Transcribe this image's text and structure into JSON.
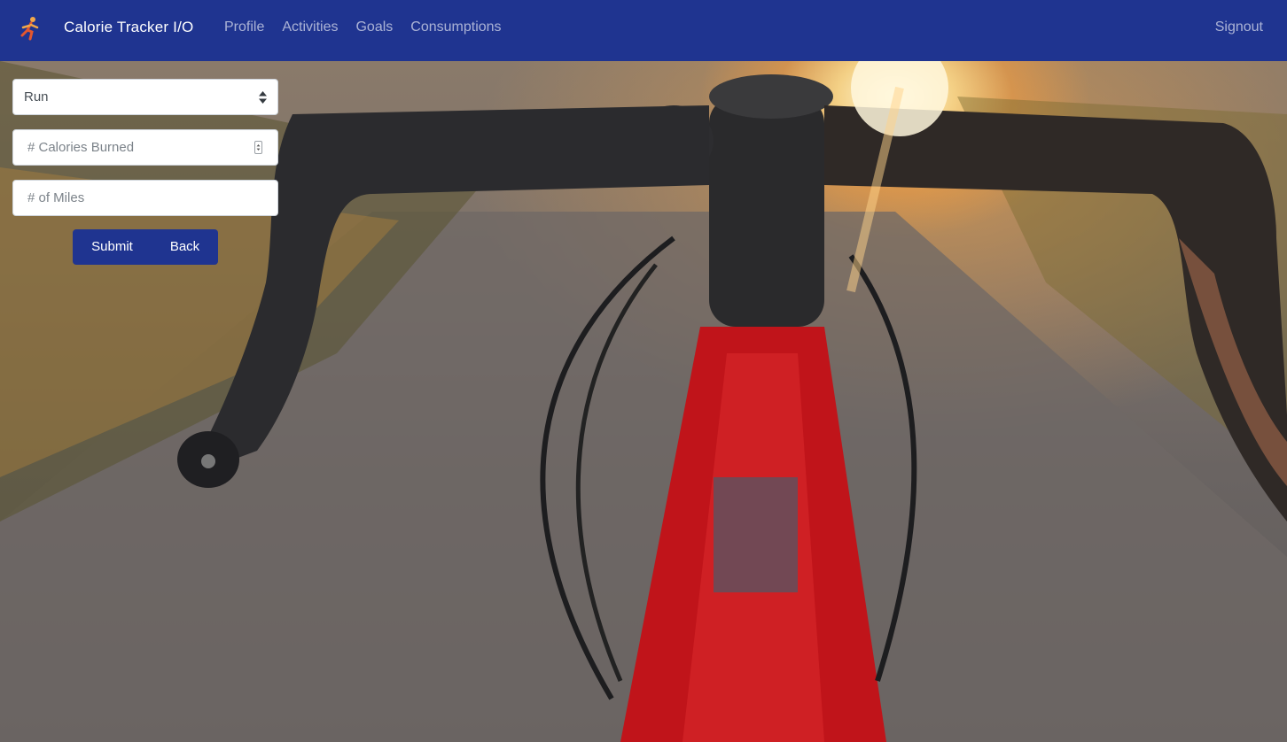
{
  "navbar": {
    "brand_name": "Calorie Tracker I/O",
    "links": [
      {
        "label": "Profile"
      },
      {
        "label": "Activities"
      },
      {
        "label": "Goals"
      },
      {
        "label": "Consumptions"
      }
    ],
    "signout_label": "Signout",
    "background_color": "#1f3490"
  },
  "form": {
    "activity_select": {
      "selected": "Run"
    },
    "calories_input": {
      "placeholder": "# Calories Burned",
      "value": ""
    },
    "miles_input": {
      "placeholder": "# of Miles",
      "value": ""
    },
    "submit_label": "Submit",
    "back_label": "Back"
  },
  "icons": {
    "brand": "runner-icon",
    "select": "select-arrows-icon",
    "stepper": "number-stepper-icon"
  }
}
